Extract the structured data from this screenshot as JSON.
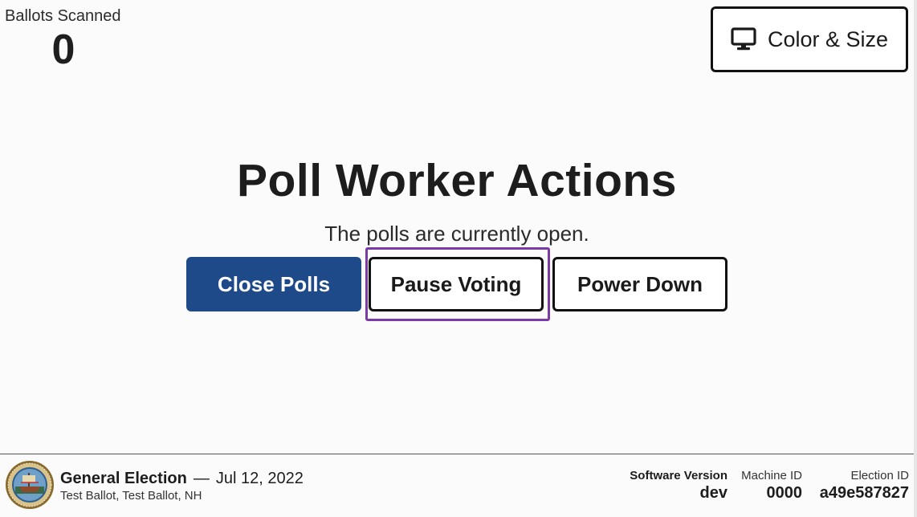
{
  "ballots": {
    "label": "Ballots Scanned",
    "count": "0"
  },
  "toolbar": {
    "color_size_label": "Color & Size",
    "color_size_icon": "monitor-icon"
  },
  "main": {
    "title": "Poll Worker Actions",
    "status": "The polls are currently open.",
    "actions": {
      "close_polls": "Close Polls",
      "pause_voting": "Pause Voting",
      "power_down": "Power Down"
    },
    "focused_action": "pause_voting"
  },
  "footer": {
    "seal_icon": "state-seal-icon",
    "election_name": "General Election",
    "dash": "—",
    "election_date": "Jul 12, 2022",
    "election_subtitle": "Test Ballot, Test Ballot, NH",
    "software_version_label": "Software Version",
    "software_version_value": "dev",
    "machine_id_label": "Machine ID",
    "machine_id_value": "0000",
    "election_id_label": "Election ID",
    "election_id_value": "a49e587827"
  },
  "colors": {
    "primary": "#1e4a8a",
    "focus": "#7a3aa8",
    "border": "#111111",
    "background": "#fbfbfb"
  }
}
